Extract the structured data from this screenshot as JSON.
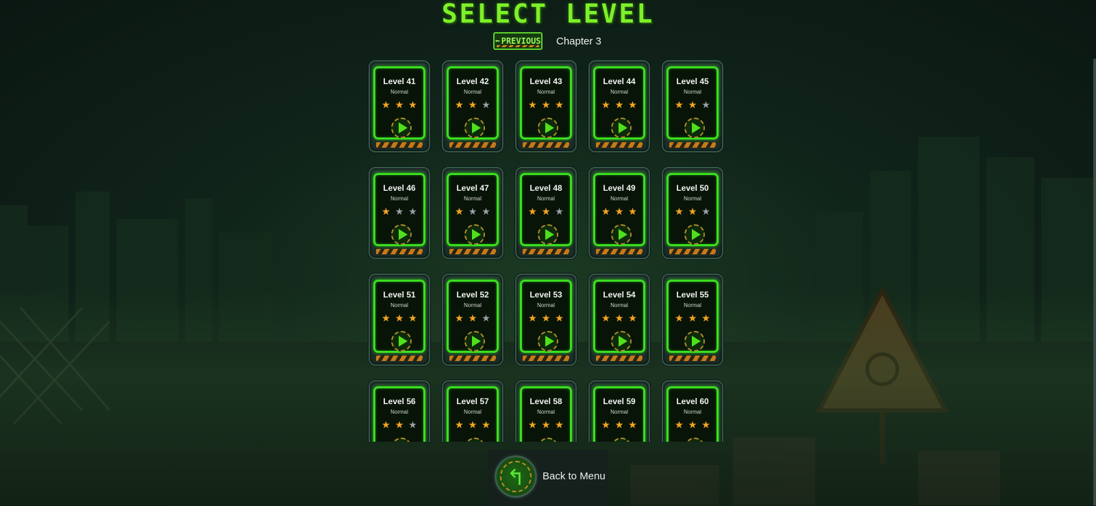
{
  "title": "SELECT LEVEL",
  "chapter": {
    "prev_label": "PREVIOUS",
    "prev_arrow": "⬅",
    "label": "Chapter 3"
  },
  "levels": [
    {
      "name": "Level 41",
      "difficulty": "Normal",
      "stars": 3
    },
    {
      "name": "Level 42",
      "difficulty": "Normal",
      "stars": 2
    },
    {
      "name": "Level 43",
      "difficulty": "Normal",
      "stars": 3
    },
    {
      "name": "Level 44",
      "difficulty": "Normal",
      "stars": 3
    },
    {
      "name": "Level 45",
      "difficulty": "Normal",
      "stars": 2
    },
    {
      "name": "Level 46",
      "difficulty": "Normal",
      "stars": 1
    },
    {
      "name": "Level 47",
      "difficulty": "Normal",
      "stars": 1
    },
    {
      "name": "Level 48",
      "difficulty": "Normal",
      "stars": 2
    },
    {
      "name": "Level 49",
      "difficulty": "Normal",
      "stars": 3
    },
    {
      "name": "Level 50",
      "difficulty": "Normal",
      "stars": 2
    },
    {
      "name": "Level 51",
      "difficulty": "Normal",
      "stars": 3
    },
    {
      "name": "Level 52",
      "difficulty": "Normal",
      "stars": 2
    },
    {
      "name": "Level 53",
      "difficulty": "Normal",
      "stars": 3
    },
    {
      "name": "Level 54",
      "difficulty": "Normal",
      "stars": 3
    },
    {
      "name": "Level 55",
      "difficulty": "Normal",
      "stars": 3
    },
    {
      "name": "Level 56",
      "difficulty": "Normal",
      "stars": 2
    },
    {
      "name": "Level 57",
      "difficulty": "Normal",
      "stars": 3
    },
    {
      "name": "Level 58",
      "difficulty": "Normal",
      "stars": 3
    },
    {
      "name": "Level 59",
      "difficulty": "Normal",
      "stars": 3
    },
    {
      "name": "Level 60",
      "difficulty": "Normal",
      "stars": 3
    }
  ],
  "max_stars": 3,
  "back": {
    "label": "Back to Menu",
    "icon": "back-arrow-icon"
  },
  "colors": {
    "accent": "#3be01f",
    "title": "#7ef02a",
    "star_on": "#f0a526",
    "star_off": "#9aa0a6"
  }
}
